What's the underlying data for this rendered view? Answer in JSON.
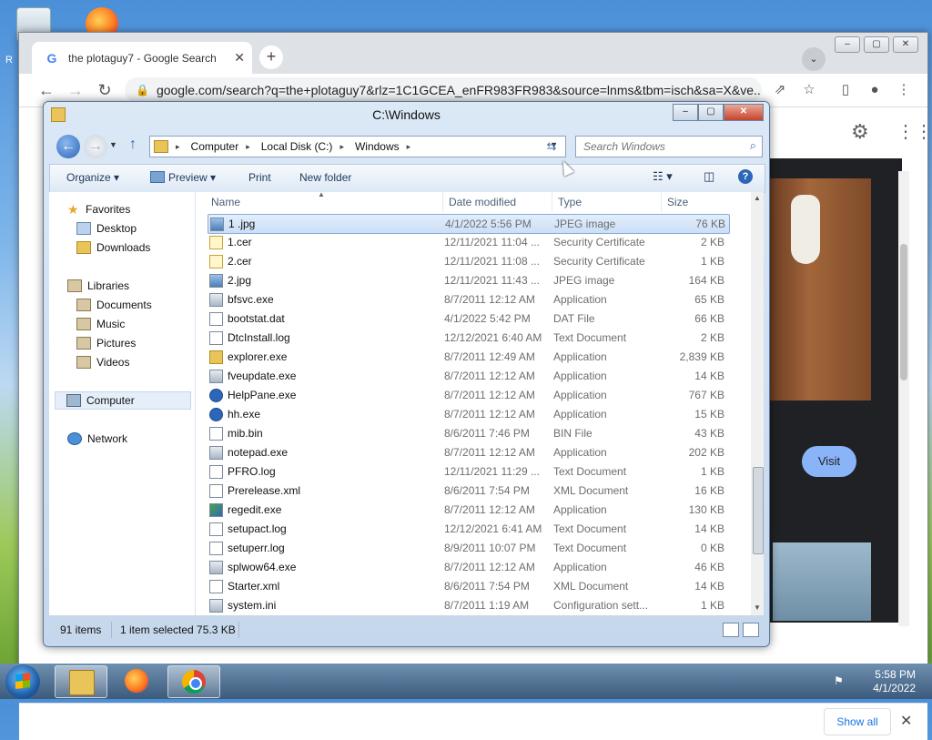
{
  "desktop": {
    "partial_label": "R"
  },
  "chrome": {
    "tab_title": "the plotaguy7 - Google Search",
    "tab_close": "✕",
    "new_tab": "+",
    "tab_search": "⌄",
    "window_min": "–",
    "window_max": "▢",
    "window_close": "✕",
    "url": "google.com/search?q=the+plotaguy7&rlz=1C1GCEA_enFR983FR983&source=lnms&tbm=isch&sa=X&ve...",
    "visit_label": "Visit",
    "show_all_label": "Show all",
    "close_downloads": "✕"
  },
  "explorer": {
    "title": "C:\\Windows",
    "breadcrumb": [
      "Computer",
      "Local Disk (C:)",
      "Windows"
    ],
    "search_placeholder": "Search Windows",
    "commands": {
      "organize": "Organize ▾",
      "preview": "Preview  ▾",
      "print": "Print",
      "new_folder": "New folder"
    },
    "nav": {
      "favorites": "Favorites",
      "desktop": "Desktop",
      "downloads": "Downloads",
      "libraries": "Libraries",
      "documents": "Documents",
      "music": "Music",
      "pictures": "Pictures",
      "videos": "Videos",
      "computer": "Computer",
      "network": "Network"
    },
    "columns": {
      "name": "Name",
      "date": "Date modified",
      "type": "Type",
      "size": "Size"
    },
    "files": [
      {
        "name": "1 .jpg",
        "date": "4/1/2022 5:56 PM",
        "type": "JPEG image",
        "size": "76 KB",
        "icon": "image-icon"
      },
      {
        "name": "1.cer",
        "date": "12/11/2021 11:04 ...",
        "type": "Security Certificate",
        "size": "2 KB",
        "icon": "certificate-icon"
      },
      {
        "name": "2.cer",
        "date": "12/11/2021 11:08 ...",
        "type": "Security Certificate",
        "size": "1 KB",
        "icon": "certificate-icon"
      },
      {
        "name": "2.jpg",
        "date": "12/11/2021 11:43 ...",
        "type": "JPEG image",
        "size": "164 KB",
        "icon": "image-icon"
      },
      {
        "name": "bfsvc.exe",
        "date": "8/7/2011 12:12 AM",
        "type": "Application",
        "size": "65 KB",
        "icon": "application-icon"
      },
      {
        "name": "bootstat.dat",
        "date": "4/1/2022 5:42 PM",
        "type": "DAT File",
        "size": "66 KB",
        "icon": "file-icon"
      },
      {
        "name": "DtcInstall.log",
        "date": "12/12/2021 6:40 AM",
        "type": "Text Document",
        "size": "2 KB",
        "icon": "text-file-icon"
      },
      {
        "name": "explorer.exe",
        "date": "8/7/2011 12:49 AM",
        "type": "Application",
        "size": "2,839 KB",
        "icon": "explorer-icon"
      },
      {
        "name": "fveupdate.exe",
        "date": "8/7/2011 12:12 AM",
        "type": "Application",
        "size": "14 KB",
        "icon": "application-icon"
      },
      {
        "name": "HelpPane.exe",
        "date": "8/7/2011 12:12 AM",
        "type": "Application",
        "size": "767 KB",
        "icon": "help-icon"
      },
      {
        "name": "hh.exe",
        "date": "8/7/2011 12:12 AM",
        "type": "Application",
        "size": "15 KB",
        "icon": "help-icon"
      },
      {
        "name": "mib.bin",
        "date": "8/6/2011 7:46 PM",
        "type": "BIN File",
        "size": "43 KB",
        "icon": "file-icon"
      },
      {
        "name": "notepad.exe",
        "date": "8/7/2011 12:12 AM",
        "type": "Application",
        "size": "202 KB",
        "icon": "notepad-icon"
      },
      {
        "name": "PFRO.log",
        "date": "12/11/2021 11:29 ...",
        "type": "Text Document",
        "size": "1 KB",
        "icon": "text-file-icon"
      },
      {
        "name": "Prerelease.xml",
        "date": "8/6/2011 7:54 PM",
        "type": "XML Document",
        "size": "16 KB",
        "icon": "xml-icon"
      },
      {
        "name": "regedit.exe",
        "date": "8/7/2011 12:12 AM",
        "type": "Application",
        "size": "130 KB",
        "icon": "regedit-icon"
      },
      {
        "name": "setupact.log",
        "date": "12/12/2021 6:41 AM",
        "type": "Text Document",
        "size": "14 KB",
        "icon": "text-file-icon"
      },
      {
        "name": "setuperr.log",
        "date": "8/9/2011 10:07 PM",
        "type": "Text Document",
        "size": "0 KB",
        "icon": "text-file-icon"
      },
      {
        "name": "splwow64.exe",
        "date": "8/7/2011 12:12 AM",
        "type": "Application",
        "size": "46 KB",
        "icon": "application-icon"
      },
      {
        "name": "Starter.xml",
        "date": "8/6/2011 7:54 PM",
        "type": "XML Document",
        "size": "14 KB",
        "icon": "xml-icon"
      },
      {
        "name": "system.ini",
        "date": "8/7/2011 1:19 AM",
        "type": "Configuration sett...",
        "size": "1 KB",
        "icon": "config-icon"
      }
    ],
    "status": {
      "items": "91 items",
      "selected": "1 item selected  75.3 KB"
    }
  },
  "taskbar": {
    "time": "5:58 PM",
    "date": "4/1/2022"
  }
}
